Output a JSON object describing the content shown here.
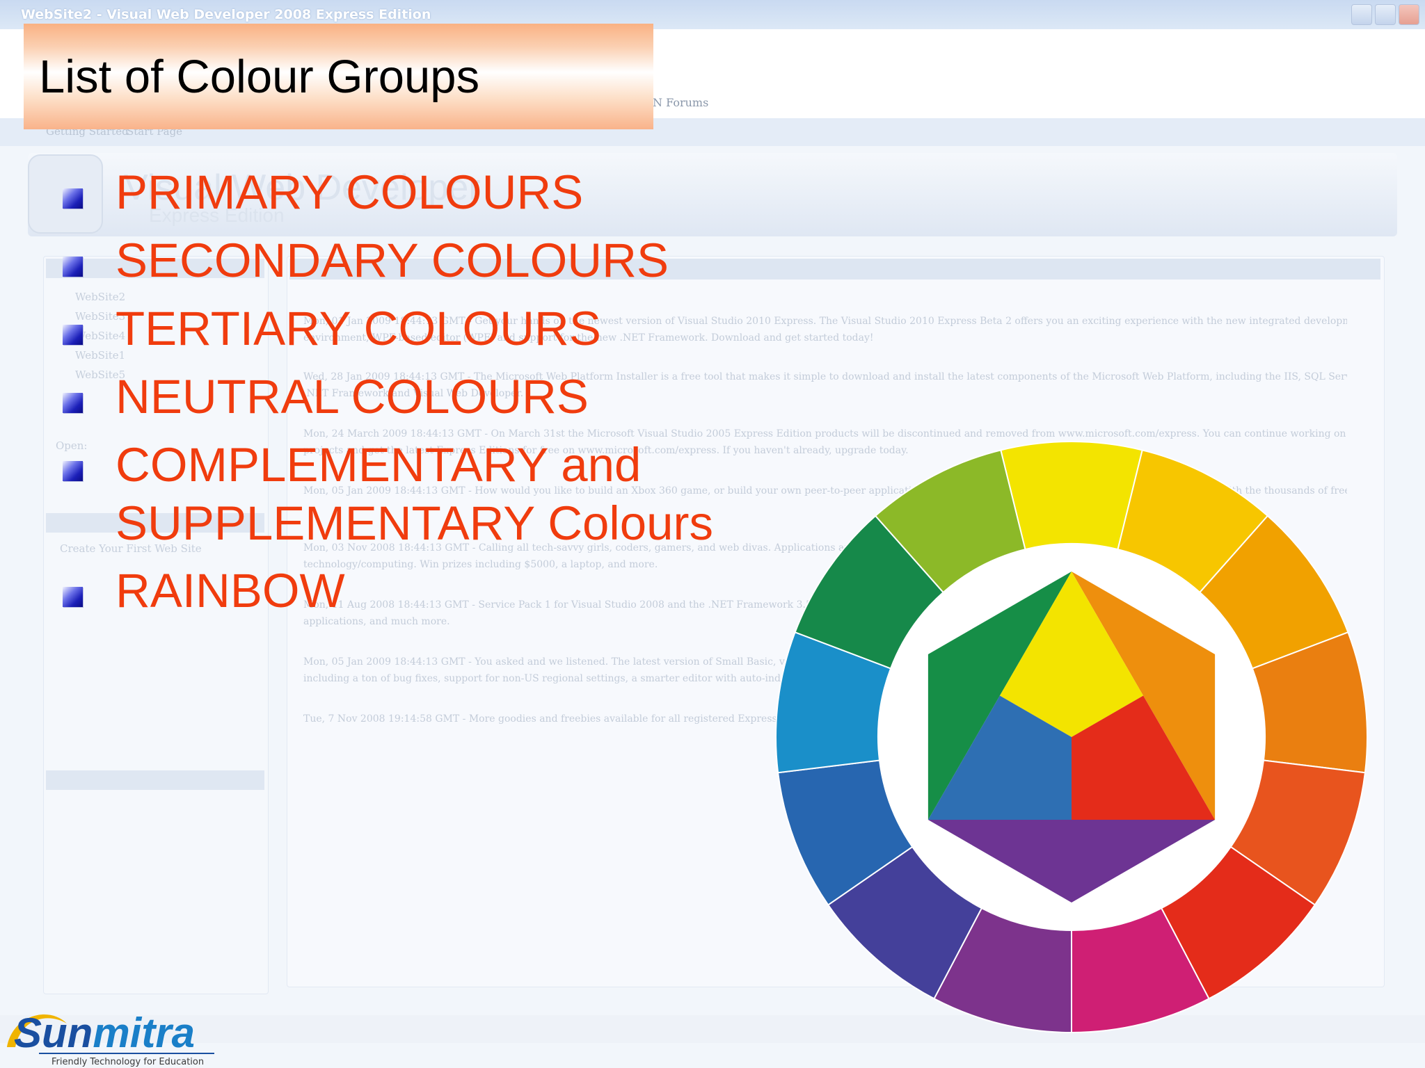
{
  "background_window": {
    "title": "WebSite2 - Visual Web Developer 2008 Express Edition",
    "forums_fragment": "N Forums",
    "tab_start_page": "Start Page",
    "tab_getting_started": "Getting Started",
    "product_name": "Visual Web Developer",
    "product_edition": "Express Edition",
    "recent_projects": [
      "WebSite2",
      "WebSite3",
      "WebSite4",
      "WebSite1",
      "WebSite5"
    ],
    "open_label": "Open:",
    "getting_started_link": "Create Your First Web Site",
    "news_items": [
      "Mon, 01 Jan 2009 18:44:13 GMT - Get your hands on the newest version of Visual Studio 2010 Express. The Visual Studio 2010 Express Beta 2 offers you an exciting experience with the new integrated development",
      "environment, WPF-based editor (WPF) and support for the new .NET Framework. Download and get started today!",
      "Wed, 28 Jan 2009 18:44:13 GMT - The Microsoft Web Platform Installer is a free tool that makes it simple to download and install the latest components of the Microsoft Web Platform, including the IIS, SQL Server Express,",
      ".NET Framework and Visual Web Developer.",
      "Mon, 24 March 2009 18:44:13 GMT - On March 31st the Microsoft Visual Studio 2005 Express Edition products will be discontinued and removed from www.microsoft.com/express. You can continue working on your current",
      "projects and get the latest Express Editions for free on www.microsoft.com/express. If you haven't already, upgrade today.",
      "Mon, 05 Jan 2009 18:44:13 GMT - How would you like to build an Xbox 360 game, or build your own peer-to-peer application? Check out the latest Coding4Fun projects and get started with the thousands of free Microsoft",
      "Mon, 03 Nov 2008 18:44:13 GMT - Calling all tech-savvy girls, coders, gamers, and web divas. Applications are now being accepted.",
      "technology/computing. Win prizes including $5000, a laptop, and more.",
      "Mon, 11 Aug 2008 18:44:13 GMT - Service Pack 1 for Visual Studio 2008 and the .NET Framework 3.5 has been released with new features for building",
      "applications, and much more.",
      "Mon, 05 Jan 2009 18:44:13 GMT - You asked and we listened. The latest version of Small Basic, version 0.2 is here with lots of new features",
      "including a ton of bug fixes, support for non-US regional settings, a smarter editor with auto-indent, and more.",
      "Tue, 7 Nov 2008 19:14:58 GMT - More goodies and freebies available for all registered Express users."
    ]
  },
  "slide": {
    "title": "List of Colour Groups",
    "bullets": [
      {
        "lines": [
          "PRIMARY COLOURS"
        ]
      },
      {
        "lines": [
          "SECONDARY COLOURS"
        ]
      },
      {
        "lines": [
          "TERTIARY COLOURS"
        ]
      },
      {
        "lines": [
          "NEUTRAL COLOURS"
        ]
      },
      {
        "lines": [
          "COMPLEMENTARY and",
          "SUPPLEMENTARY Colours"
        ]
      },
      {
        "lines": [
          "RAINBOW"
        ]
      }
    ],
    "bullet_text_color": "#f03c0e",
    "title_banner_color": "#f9b183"
  },
  "colour_wheel": {
    "outer_ring_colors": [
      "#f3e400",
      "#f7c600",
      "#f1a100",
      "#ea7f10",
      "#e8541e",
      "#e42c1a",
      "#cf1f74",
      "#7d338c",
      "#44409a",
      "#2766b0",
      "#1a8fc9",
      "#16894a",
      "#8cb928"
    ],
    "inner_triangle_colors": {
      "yellow": "#f3e400",
      "red": "#e42c1a",
      "blue": "#2e6fb3"
    },
    "inner_hexagon_colors": {
      "orange": "#ee8f0d",
      "purple": "#6d3493",
      "green": "#168e47"
    }
  },
  "logo": {
    "brand_part1": "Sun",
    "brand_part2": "mitra",
    "tagline": "Friendly Technology for Education",
    "brand_color_1": "#1a4fa0",
    "brand_color_2": "#1a7fc8",
    "swoosh_color": "#f0b400"
  }
}
